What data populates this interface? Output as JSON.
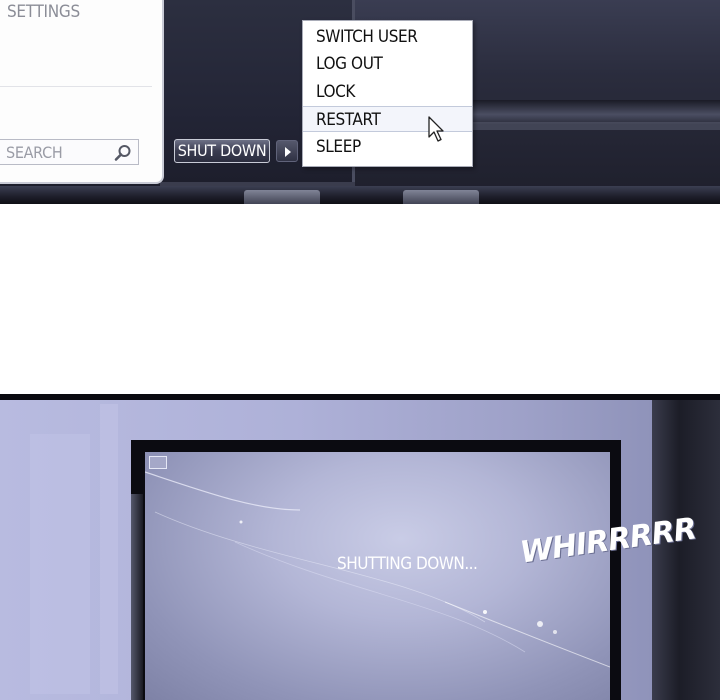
{
  "start_menu": {
    "settings_label": "SETTINGS",
    "search_placeholder": "SEARCH",
    "shutdown_label": "SHUT DOWN"
  },
  "power_menu": {
    "items": [
      {
        "label": "SWITCH USER"
      },
      {
        "label": "LOG OUT"
      },
      {
        "label": "LOCK"
      },
      {
        "label": "RESTART",
        "highlighted": true
      },
      {
        "label": "SLEEP"
      }
    ]
  },
  "monitor": {
    "status_text": "SHUTTING DOWN..."
  },
  "sound_effect": "WHIRRRRR",
  "icons": [
    "search-icon",
    "arrow-right-icon",
    "mouse-cursor-icon",
    "windows-logo-icon"
  ],
  "colors": {
    "desktop": "#232536",
    "menu_background": "#ffffff",
    "highlight": "#f3f5fb",
    "screen_glow": "#b3b6d6"
  }
}
